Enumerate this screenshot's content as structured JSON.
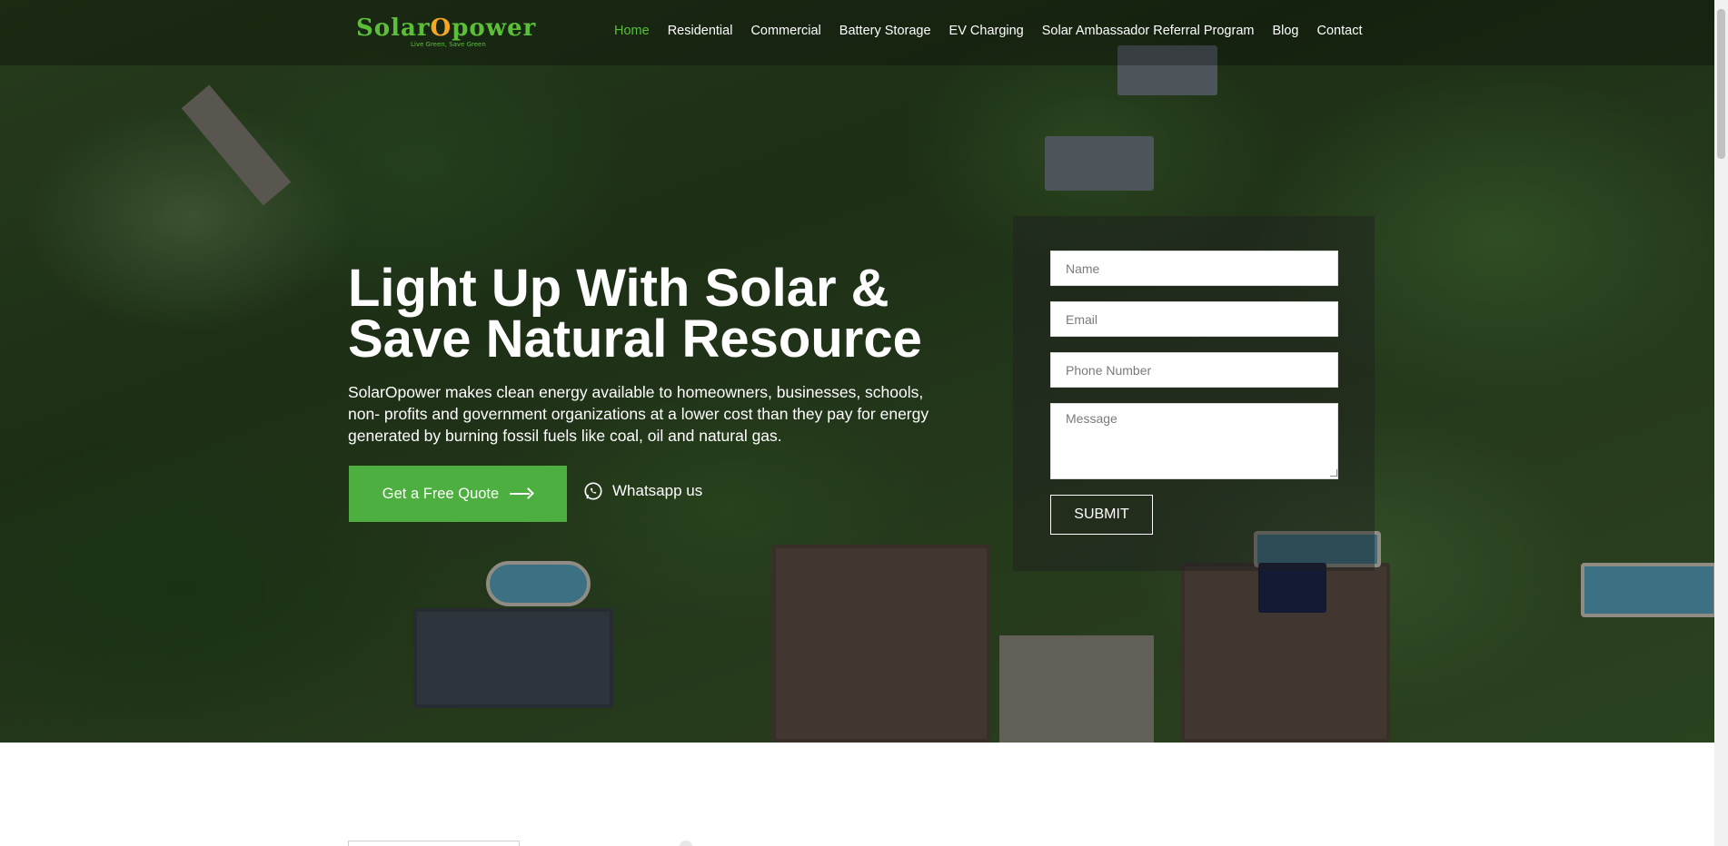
{
  "brand": {
    "logo_text_part1": "Solar",
    "logo_text_o": "O",
    "logo_text_part2": "power",
    "logo_tagline": "Live Green, Save Green",
    "accent_color": "#4caf3f"
  },
  "nav": {
    "items": [
      {
        "label": "Home",
        "active": true
      },
      {
        "label": "Residential"
      },
      {
        "label": "Commercial"
      },
      {
        "label": "Battery Storage"
      },
      {
        "label": "EV Charging"
      },
      {
        "label": "Solar Ambassador Referral Program"
      },
      {
        "label": "Blog"
      },
      {
        "label": "Contact"
      }
    ]
  },
  "hero": {
    "title_line1": "Light Up With Solar &",
    "title_line2": "Save Natural Resource",
    "description": "SolarOpower makes clean energy available to homeowners, businesses, schools, non- profits and government organizations at a lower cost than they pay for energy generated by burning fossil fuels like coal, oil and natural gas.",
    "quote_button": "Get a Free Quote",
    "whatsapp_label": "Whatsapp us"
  },
  "form": {
    "name_placeholder": "Name",
    "email_placeholder": "Email",
    "phone_placeholder": "Phone Number",
    "message_placeholder": "Message",
    "submit_label": "SUBMIT"
  },
  "icons": {
    "arrow": "arrow-right-icon",
    "whatsapp": "whatsapp-icon"
  }
}
